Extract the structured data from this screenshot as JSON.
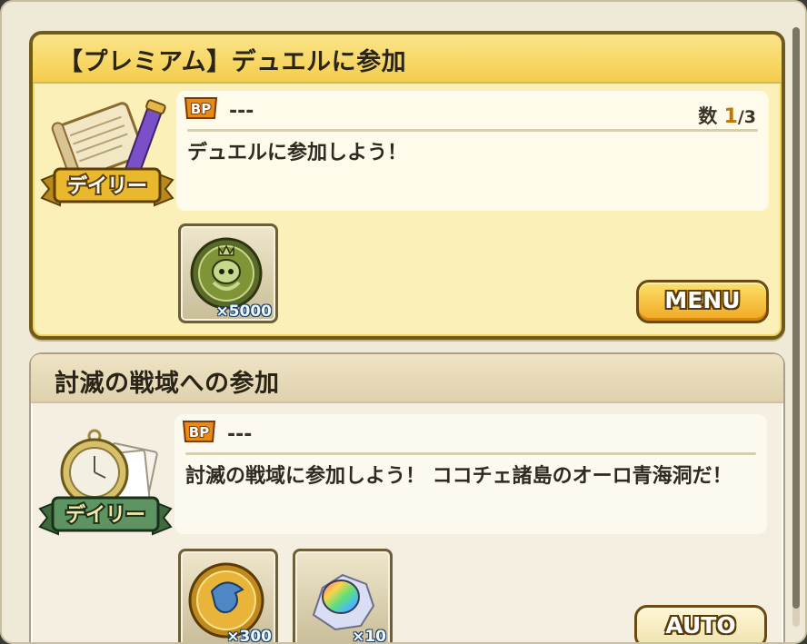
{
  "quests": [
    {
      "title": "【プレミアム】デュエルに参加",
      "badge_label": "デイリー",
      "bp_value": "---",
      "count_label": "数",
      "count_current": "1",
      "count_total": "/3",
      "description": "デュエルに参加しよう！",
      "rewards": [
        {
          "icon": "green-medal-icon",
          "qty": "×5000"
        }
      ],
      "button_label": "MENU"
    },
    {
      "title": "討滅の戦域への参加",
      "badge_label": "デイリー",
      "bp_value": "---",
      "description": "討滅の戦域に参加しよう！ ココチェ諸島のオーロ青海洞だ！",
      "rewards": [
        {
          "icon": "gold-coin-icon",
          "qty": "×300"
        },
        {
          "icon": "rainbow-gem-icon",
          "qty": "×10"
        }
      ],
      "button_label": "AUTO"
    }
  ],
  "colors": {
    "premium_bg": "#fbf0b8",
    "premium_header": "#f4cd4c",
    "normal_bg": "#f4efe0",
    "button_gold": "#f0a822"
  }
}
